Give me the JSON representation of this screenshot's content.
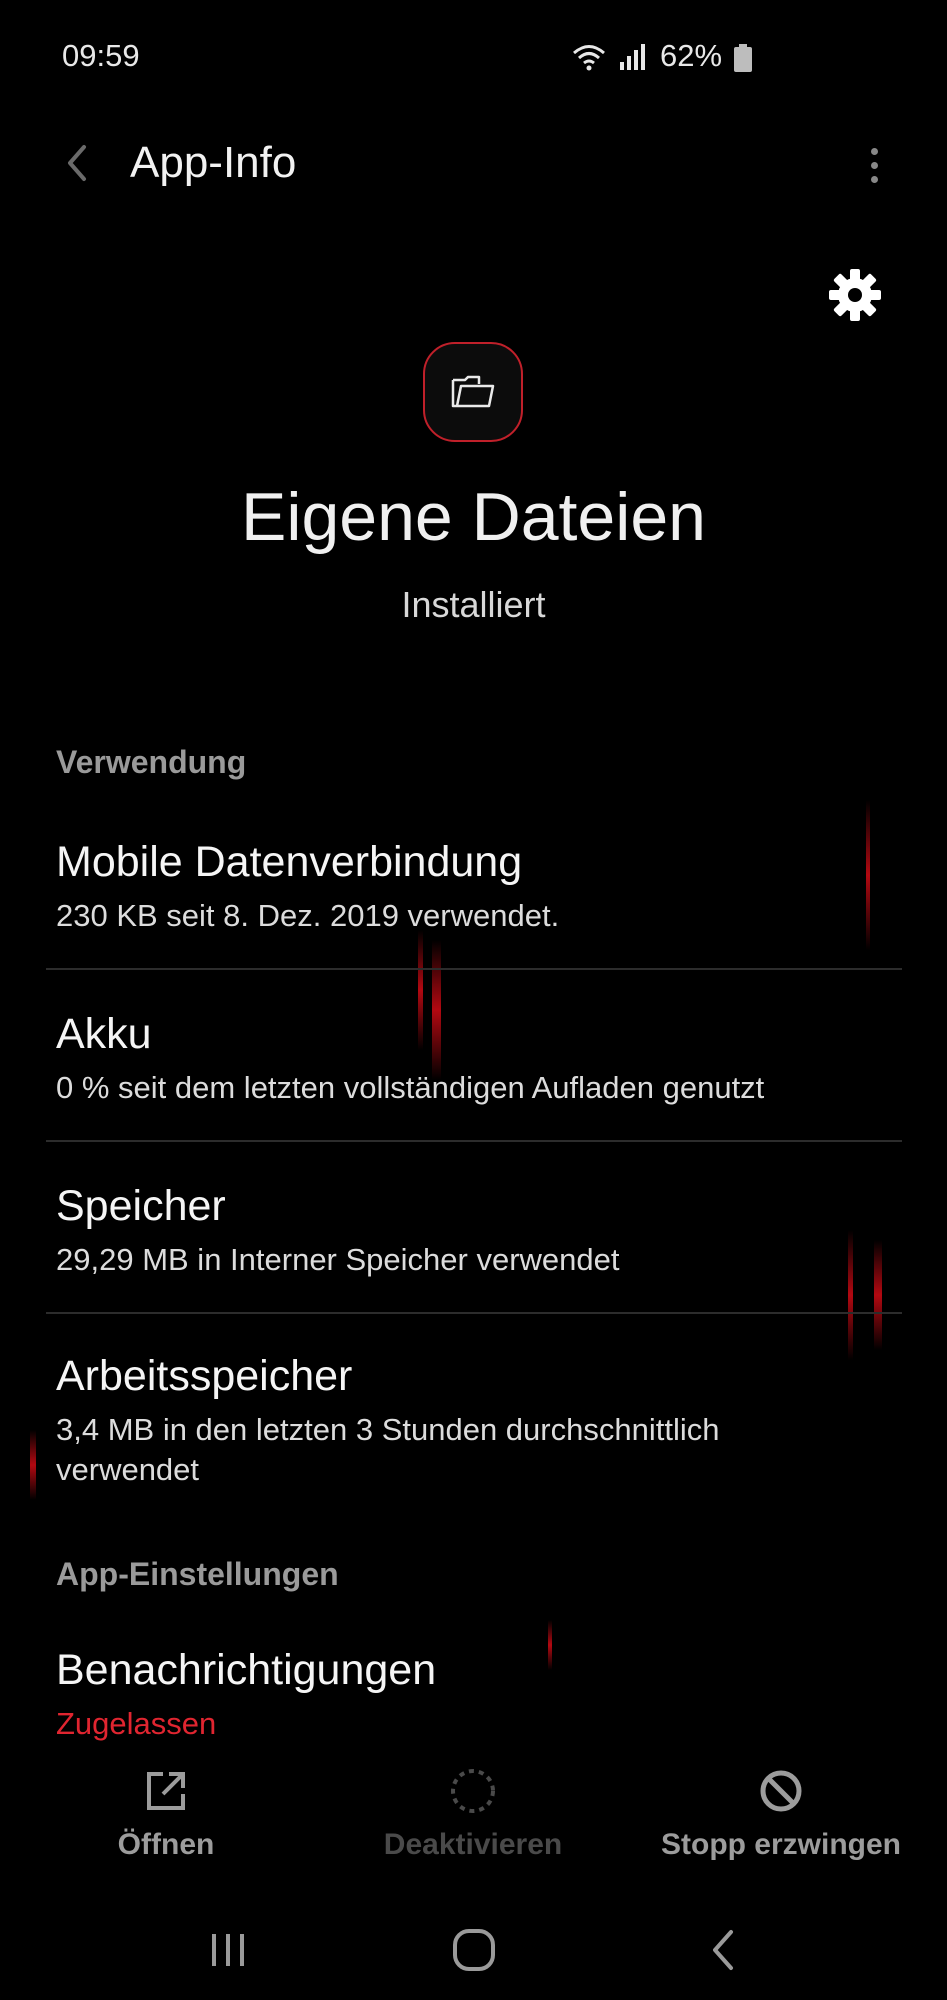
{
  "status_bar": {
    "time": "09:59",
    "battery_percent": "62%",
    "icons": [
      "wifi-icon",
      "signal-icon",
      "battery-icon"
    ]
  },
  "top_bar": {
    "title": "App-Info",
    "back_icon": "back-arrow-icon",
    "more_icon": "more-vert-icon"
  },
  "app": {
    "name": "Eigene Dateien",
    "status": "Installiert",
    "icon": "folder-icon",
    "settings_icon": "gear-icon"
  },
  "sections": {
    "usage_header": "Verwendung",
    "usage_items": [
      {
        "title": "Mobile Datenverbindung",
        "subtitle": "230 KB seit 8. Dez. 2019 verwendet."
      },
      {
        "title": "Akku",
        "subtitle": "0 % seit dem letzten vollständigen Aufladen genutzt"
      },
      {
        "title": "Speicher",
        "subtitle": "29,29 MB in Interner Speicher verwendet"
      },
      {
        "title": "Arbeitsspeicher",
        "subtitle": "3,4 MB in den letzten 3 Stunden durchschnittlich verwendet"
      }
    ],
    "settings_header": "App-Einstellungen",
    "settings_items": [
      {
        "title": "Benachrichtigungen",
        "subtitle": "Zugelassen"
      }
    ]
  },
  "actions": [
    {
      "label": "Öffnen",
      "icon": "open-external-icon",
      "enabled": true
    },
    {
      "label": "Deaktivieren",
      "icon": "disable-circle-icon",
      "enabled": false
    },
    {
      "label": "Stopp erzwingen",
      "icon": "stop-block-icon",
      "enabled": true
    }
  ],
  "nav_bar": [
    "recents-icon",
    "home-icon",
    "back-icon"
  ],
  "colors": {
    "background": "#000000",
    "accent": "#e02530",
    "secondary_text": "#9a9a9a"
  }
}
